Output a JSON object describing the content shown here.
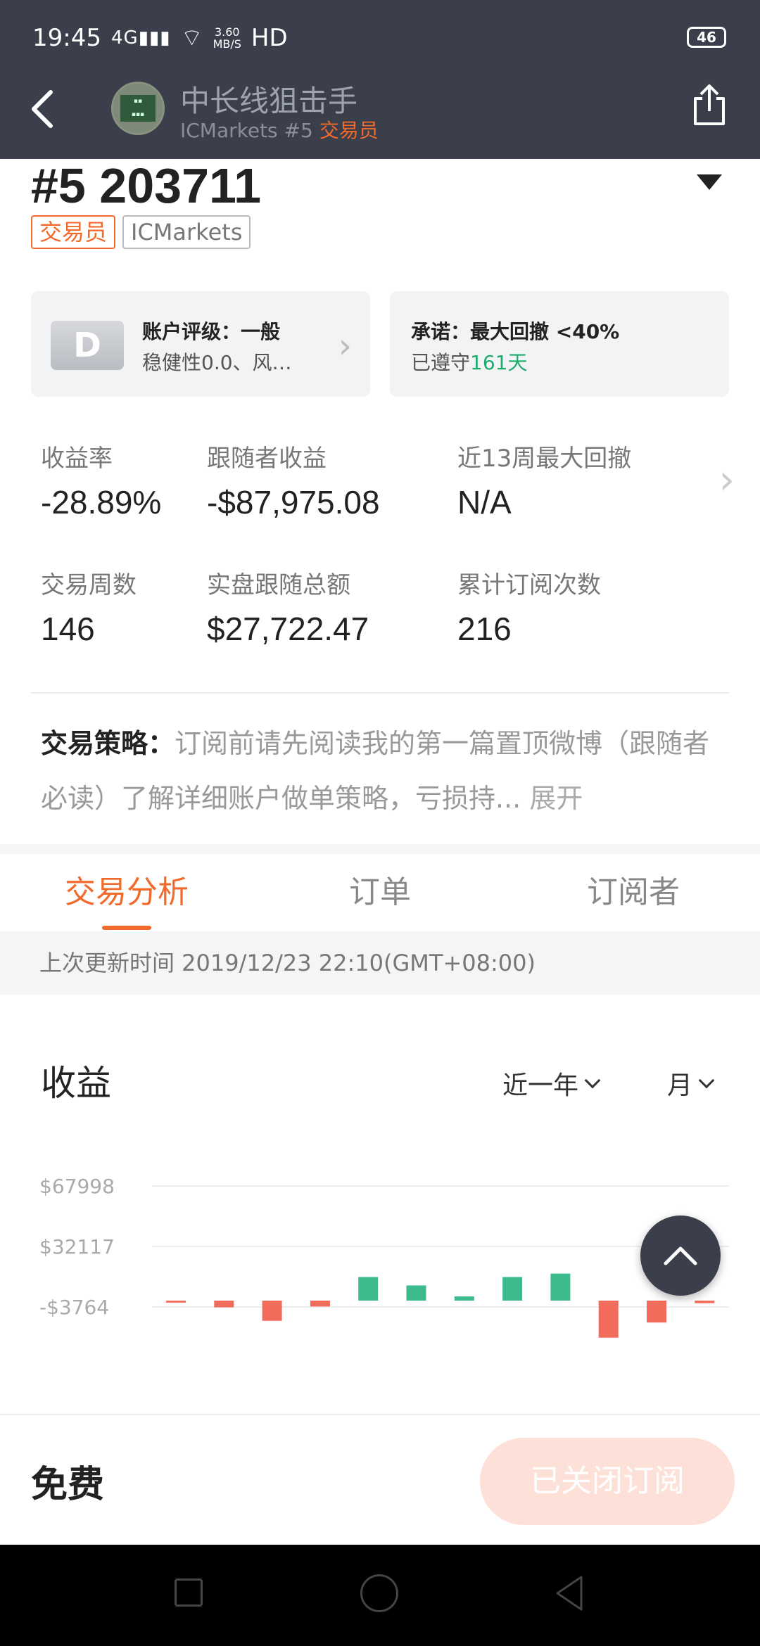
{
  "status_bar": {
    "time": "19:45",
    "signal": "4G",
    "speed_value": "3.60",
    "speed_unit": "MB/S",
    "hd": "HD",
    "battery": "46"
  },
  "header": {
    "title": "中长线狙击手",
    "subtitle_prefix": "ICMarkets #5",
    "subtitle_role": "交易员"
  },
  "account": {
    "number": "#5 203711",
    "tags": [
      "交易员",
      "ICMarkets"
    ]
  },
  "cards": {
    "rating_letter": "D",
    "rating_title": "账户评级：一般",
    "rating_sub": "稳健性0.0、风…",
    "promise_title": "承诺：最大回撤 <40%",
    "promise_sub_prefix": "已遵守",
    "promise_sub_days": "161天"
  },
  "stats": {
    "return_label": "收益率",
    "return_value": "-28.89%",
    "follower_profit_label": "跟随者收益",
    "follower_profit_value": "-$87,975.08",
    "max_dd_label": "近13周最大回撤",
    "max_dd_value": "N/A",
    "weeks_label": "交易周数",
    "weeks_value": "146",
    "follow_total_label": "实盘跟随总额",
    "follow_total_value": "$27,722.47",
    "subs_label": "累计订阅次数",
    "subs_value": "216"
  },
  "strategy": {
    "label": "交易策略：",
    "text": "订阅前请先阅读我的第一篇置顶微博（跟随者必读）了解详细账户做单策略，亏损持...",
    "expand": "展开"
  },
  "tabs": [
    "交易分析",
    "订单",
    "订阅者"
  ],
  "updated": "上次更新时间 2019/12/23 22:10(GMT+08:00)",
  "profit_section": {
    "title": "收益",
    "range_select": "近一年",
    "period_select": "月"
  },
  "chart_data": {
    "type": "bar",
    "title": "收益",
    "y_ticks": [
      "$67998",
      "$32117",
      "-$3764"
    ],
    "y_tick_values": [
      67998,
      32117,
      -3764
    ],
    "values": [
      -1200,
      -4000,
      -12000,
      -3500,
      14000,
      9000,
      2500,
      14000,
      16000,
      -22000,
      -13000,
      -1500
    ],
    "positive_color": "#3dbb8d",
    "negative_color": "#f26b5b",
    "note": ""
  },
  "bottom": {
    "price": "免费",
    "button": "已关闭订阅"
  }
}
